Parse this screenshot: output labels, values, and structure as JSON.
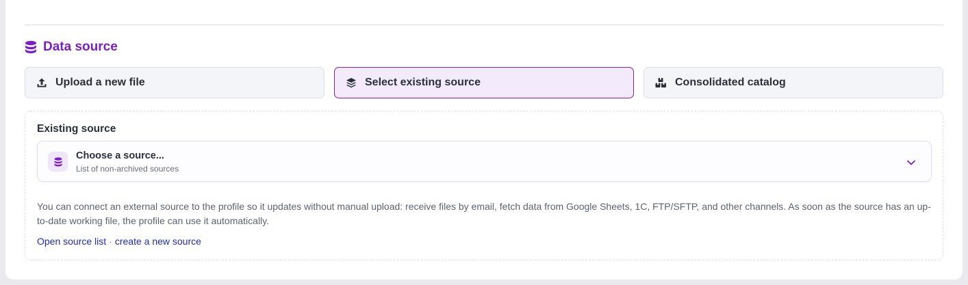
{
  "section": {
    "title": "Data source",
    "icon": "database-icon",
    "accent_color": "#7a1fc4"
  },
  "mode_tabs": [
    {
      "label": "Upload a new file",
      "icon": "upload-icon",
      "active": false
    },
    {
      "label": "Select existing source",
      "icon": "layers-icon",
      "active": true
    },
    {
      "label": "Consolidated catalog",
      "icon": "boxes-icon",
      "active": false
    }
  ],
  "existing_source": {
    "label": "Existing source",
    "select": {
      "value": "Choose a source...",
      "hint": "List of non-archived sources",
      "icon": "database-icon"
    },
    "help_text": "You can connect an external source to the profile so it updates without manual upload: receive files by email, fetch data from Google Sheets, 1C, FTP/SFTP, and other channels. As soon as the source has an up-to-date working file, the profile can use it automatically.",
    "links": {
      "open_list": "Open source list",
      "separator": "·",
      "create_new": "create a new source"
    }
  }
}
